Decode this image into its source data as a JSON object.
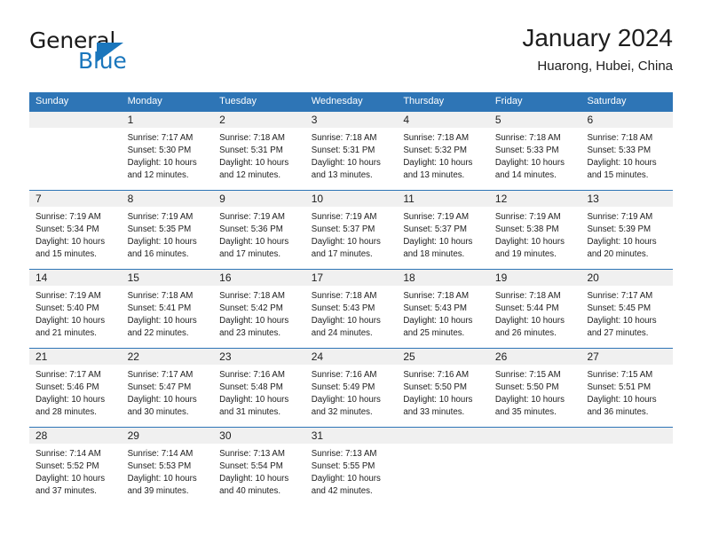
{
  "logo": {
    "word1": "General",
    "word2": "Blue",
    "triangle_color": "#1a76bc",
    "blue_color": "#1a76bc",
    "dark_color": "#1a1a1a"
  },
  "header": {
    "title": "January 2024",
    "location": "Huarong, Hubei, China"
  },
  "theme": {
    "header_blue": "#2e75b6",
    "day_band_gray": "#f0f0f0",
    "text_color": "#1d1d1d"
  },
  "weekdays": [
    "Sunday",
    "Monday",
    "Tuesday",
    "Wednesday",
    "Thursday",
    "Friday",
    "Saturday"
  ],
  "weeks": [
    [
      {
        "day": "",
        "lines": []
      },
      {
        "day": "1",
        "lines": [
          "Sunrise: 7:17 AM",
          "Sunset: 5:30 PM",
          "Daylight: 10 hours",
          "and 12 minutes."
        ]
      },
      {
        "day": "2",
        "lines": [
          "Sunrise: 7:18 AM",
          "Sunset: 5:31 PM",
          "Daylight: 10 hours",
          "and 12 minutes."
        ]
      },
      {
        "day": "3",
        "lines": [
          "Sunrise: 7:18 AM",
          "Sunset: 5:31 PM",
          "Daylight: 10 hours",
          "and 13 minutes."
        ]
      },
      {
        "day": "4",
        "lines": [
          "Sunrise: 7:18 AM",
          "Sunset: 5:32 PM",
          "Daylight: 10 hours",
          "and 13 minutes."
        ]
      },
      {
        "day": "5",
        "lines": [
          "Sunrise: 7:18 AM",
          "Sunset: 5:33 PM",
          "Daylight: 10 hours",
          "and 14 minutes."
        ]
      },
      {
        "day": "6",
        "lines": [
          "Sunrise: 7:18 AM",
          "Sunset: 5:33 PM",
          "Daylight: 10 hours",
          "and 15 minutes."
        ]
      }
    ],
    [
      {
        "day": "7",
        "lines": [
          "Sunrise: 7:19 AM",
          "Sunset: 5:34 PM",
          "Daylight: 10 hours",
          "and 15 minutes."
        ]
      },
      {
        "day": "8",
        "lines": [
          "Sunrise: 7:19 AM",
          "Sunset: 5:35 PM",
          "Daylight: 10 hours",
          "and 16 minutes."
        ]
      },
      {
        "day": "9",
        "lines": [
          "Sunrise: 7:19 AM",
          "Sunset: 5:36 PM",
          "Daylight: 10 hours",
          "and 17 minutes."
        ]
      },
      {
        "day": "10",
        "lines": [
          "Sunrise: 7:19 AM",
          "Sunset: 5:37 PM",
          "Daylight: 10 hours",
          "and 17 minutes."
        ]
      },
      {
        "day": "11",
        "lines": [
          "Sunrise: 7:19 AM",
          "Sunset: 5:37 PM",
          "Daylight: 10 hours",
          "and 18 minutes."
        ]
      },
      {
        "day": "12",
        "lines": [
          "Sunrise: 7:19 AM",
          "Sunset: 5:38 PM",
          "Daylight: 10 hours",
          "and 19 minutes."
        ]
      },
      {
        "day": "13",
        "lines": [
          "Sunrise: 7:19 AM",
          "Sunset: 5:39 PM",
          "Daylight: 10 hours",
          "and 20 minutes."
        ]
      }
    ],
    [
      {
        "day": "14",
        "lines": [
          "Sunrise: 7:19 AM",
          "Sunset: 5:40 PM",
          "Daylight: 10 hours",
          "and 21 minutes."
        ]
      },
      {
        "day": "15",
        "lines": [
          "Sunrise: 7:18 AM",
          "Sunset: 5:41 PM",
          "Daylight: 10 hours",
          "and 22 minutes."
        ]
      },
      {
        "day": "16",
        "lines": [
          "Sunrise: 7:18 AM",
          "Sunset: 5:42 PM",
          "Daylight: 10 hours",
          "and 23 minutes."
        ]
      },
      {
        "day": "17",
        "lines": [
          "Sunrise: 7:18 AM",
          "Sunset: 5:43 PM",
          "Daylight: 10 hours",
          "and 24 minutes."
        ]
      },
      {
        "day": "18",
        "lines": [
          "Sunrise: 7:18 AM",
          "Sunset: 5:43 PM",
          "Daylight: 10 hours",
          "and 25 minutes."
        ]
      },
      {
        "day": "19",
        "lines": [
          "Sunrise: 7:18 AM",
          "Sunset: 5:44 PM",
          "Daylight: 10 hours",
          "and 26 minutes."
        ]
      },
      {
        "day": "20",
        "lines": [
          "Sunrise: 7:17 AM",
          "Sunset: 5:45 PM",
          "Daylight: 10 hours",
          "and 27 minutes."
        ]
      }
    ],
    [
      {
        "day": "21",
        "lines": [
          "Sunrise: 7:17 AM",
          "Sunset: 5:46 PM",
          "Daylight: 10 hours",
          "and 28 minutes."
        ]
      },
      {
        "day": "22",
        "lines": [
          "Sunrise: 7:17 AM",
          "Sunset: 5:47 PM",
          "Daylight: 10 hours",
          "and 30 minutes."
        ]
      },
      {
        "day": "23",
        "lines": [
          "Sunrise: 7:16 AM",
          "Sunset: 5:48 PM",
          "Daylight: 10 hours",
          "and 31 minutes."
        ]
      },
      {
        "day": "24",
        "lines": [
          "Sunrise: 7:16 AM",
          "Sunset: 5:49 PM",
          "Daylight: 10 hours",
          "and 32 minutes."
        ]
      },
      {
        "day": "25",
        "lines": [
          "Sunrise: 7:16 AM",
          "Sunset: 5:50 PM",
          "Daylight: 10 hours",
          "and 33 minutes."
        ]
      },
      {
        "day": "26",
        "lines": [
          "Sunrise: 7:15 AM",
          "Sunset: 5:50 PM",
          "Daylight: 10 hours",
          "and 35 minutes."
        ]
      },
      {
        "day": "27",
        "lines": [
          "Sunrise: 7:15 AM",
          "Sunset: 5:51 PM",
          "Daylight: 10 hours",
          "and 36 minutes."
        ]
      }
    ],
    [
      {
        "day": "28",
        "lines": [
          "Sunrise: 7:14 AM",
          "Sunset: 5:52 PM",
          "Daylight: 10 hours",
          "and 37 minutes."
        ]
      },
      {
        "day": "29",
        "lines": [
          "Sunrise: 7:14 AM",
          "Sunset: 5:53 PM",
          "Daylight: 10 hours",
          "and 39 minutes."
        ]
      },
      {
        "day": "30",
        "lines": [
          "Sunrise: 7:13 AM",
          "Sunset: 5:54 PM",
          "Daylight: 10 hours",
          "and 40 minutes."
        ]
      },
      {
        "day": "31",
        "lines": [
          "Sunrise: 7:13 AM",
          "Sunset: 5:55 PM",
          "Daylight: 10 hours",
          "and 42 minutes."
        ]
      },
      {
        "day": "",
        "lines": []
      },
      {
        "day": "",
        "lines": []
      },
      {
        "day": "",
        "lines": []
      }
    ]
  ]
}
